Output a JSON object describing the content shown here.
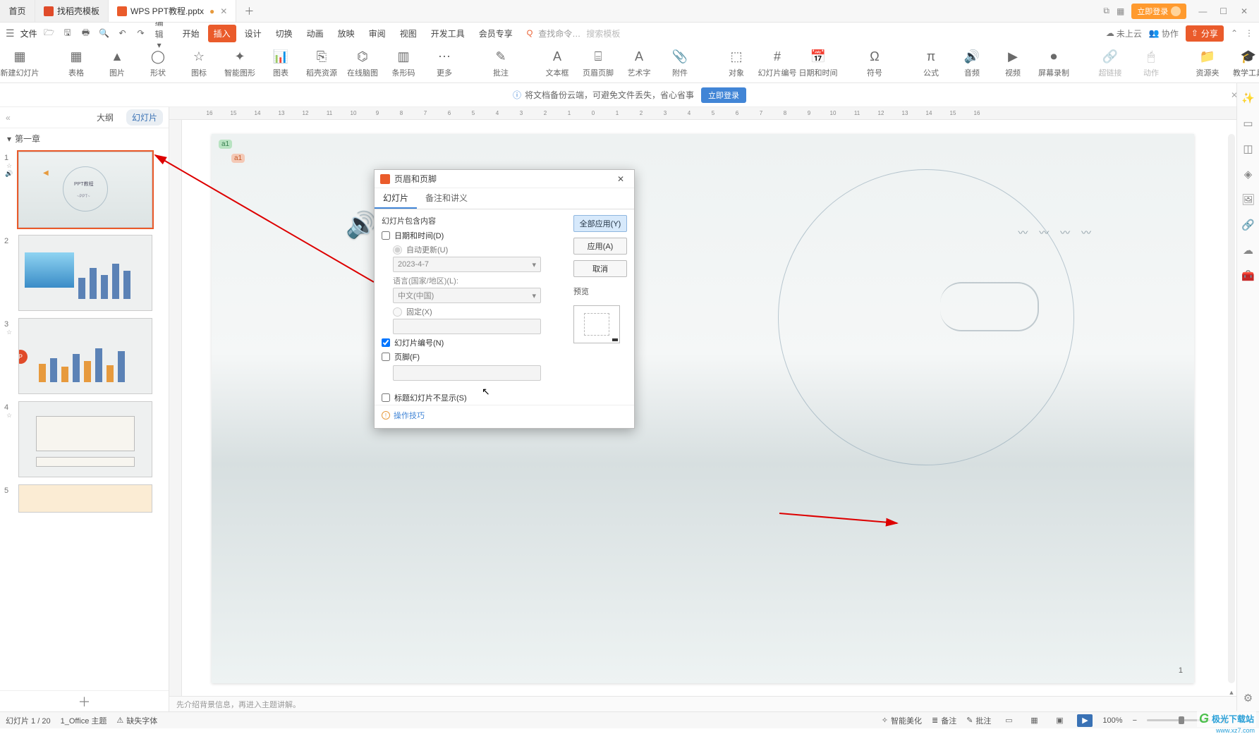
{
  "tabs": {
    "home": "首页",
    "template": "找稻壳模板",
    "current": "WPS PPT教程.pptx"
  },
  "title_right": {
    "login": "立即登录"
  },
  "menu": {
    "file": "文件",
    "edit_drop": "编辑"
  },
  "ribbon": {
    "tabs": [
      "开始",
      "插入",
      "设计",
      "切换",
      "动画",
      "放映",
      "审阅",
      "视图",
      "开发工具",
      "会员专享"
    ],
    "active_index": 1,
    "search_cmd": "查找命令…",
    "search_tpl": "搜索模板"
  },
  "right_menus": {
    "cloud": "未上云",
    "coop": "协作",
    "share": "分享"
  },
  "toolbar": [
    {
      "key": "newSlide",
      "label": "新建幻灯片",
      "glyph": "▦"
    },
    {
      "key": "table",
      "label": "表格",
      "glyph": "▦"
    },
    {
      "key": "image",
      "label": "图片",
      "glyph": "▲"
    },
    {
      "key": "shape",
      "label": "形状",
      "glyph": "◯"
    },
    {
      "key": "icon",
      "label": "图标",
      "glyph": "☆"
    },
    {
      "key": "smart",
      "label": "智能图形",
      "glyph": "✦"
    },
    {
      "key": "chart",
      "label": "图表",
      "glyph": "📊"
    },
    {
      "key": "daoke",
      "label": "稻壳资源",
      "glyph": "⎘"
    },
    {
      "key": "mindmap",
      "label": "在线脑图",
      "glyph": "⌬"
    },
    {
      "key": "barcode",
      "label": "条形码",
      "glyph": "▥"
    },
    {
      "key": "more",
      "label": "更多",
      "glyph": "⋯"
    },
    {
      "key": "comment",
      "label": "批注",
      "glyph": "✎"
    },
    {
      "key": "textbox",
      "label": "文本框",
      "glyph": "A"
    },
    {
      "key": "headerfooter",
      "label": "页眉页脚",
      "glyph": "⌸"
    },
    {
      "key": "wordart",
      "label": "艺术字",
      "glyph": "A"
    },
    {
      "key": "attach",
      "label": "附件",
      "glyph": "📎"
    },
    {
      "key": "object",
      "label": "对象",
      "glyph": "⬚",
      "inline": true
    },
    {
      "key": "slidenum",
      "label": "幻灯片编号",
      "glyph": "#",
      "inline": true
    },
    {
      "key": "datetime",
      "label": "日期和时间",
      "glyph": "📅",
      "inline": true
    },
    {
      "key": "symbol",
      "label": "符号",
      "glyph": "Ω"
    },
    {
      "key": "formula",
      "label": "公式",
      "glyph": "π"
    },
    {
      "key": "audio",
      "label": "音频",
      "glyph": "🔊"
    },
    {
      "key": "video",
      "label": "视频",
      "glyph": "▶"
    },
    {
      "key": "screenrec",
      "label": "屏幕录制",
      "glyph": "⏺"
    },
    {
      "key": "hyperlink",
      "label": "超链接",
      "glyph": "🔗",
      "dim": true
    },
    {
      "key": "action",
      "label": "动作",
      "glyph": "🖱",
      "dim": true
    },
    {
      "key": "resource",
      "label": "资源夹",
      "glyph": "📁"
    },
    {
      "key": "teach",
      "label": "教学工具",
      "glyph": "🎓"
    }
  ],
  "banner": {
    "text": "将文档备份云端，可避免文件丢失，省心省事",
    "btn": "立即登录"
  },
  "outline": {
    "tab_outline": "大纲",
    "tab_slides": "幻灯片",
    "chapter": "第一章",
    "numbers": [
      "1",
      "2",
      "3",
      "4",
      "5"
    ]
  },
  "ruler_ticks": [
    "16",
    "15",
    "14",
    "13",
    "12",
    "11",
    "10",
    "9",
    "8",
    "7",
    "6",
    "5",
    "4",
    "3",
    "2",
    "1",
    "0",
    "1",
    "2",
    "3",
    "4",
    "5",
    "6",
    "7",
    "8",
    "9",
    "10",
    "11",
    "12",
    "13",
    "14",
    "15",
    "16"
  ],
  "slide": {
    "annot1": "a1",
    "annot2": "a1",
    "page_number": "1",
    "birds": "〰 〰 〰 〰"
  },
  "dialog": {
    "title": "页眉和页脚",
    "tab_slide": "幻灯片",
    "tab_notes": "备注和讲义",
    "group_title": "幻灯片包含内容",
    "datetime": "日期和时间(D)",
    "auto": "自动更新(U)",
    "date_value": "2023-4-7",
    "lang_label": "语言(国家/地区)(L):",
    "lang_value": "中文(中国)",
    "fixed": "固定(X)",
    "slidenum": "幻灯片编号(N)",
    "footer": "页脚(F)",
    "hide_title": "标题幻灯片不显示(S)",
    "apply_all": "全部应用(Y)",
    "apply": "应用(A)",
    "cancel": "取消",
    "preview": "预览",
    "tips": "操作技巧"
  },
  "notes_placeholder": "先介绍背景信息，再进入主题讲解。",
  "status": {
    "slide": "幻灯片 1 / 20",
    "theme": "1_Office 主题",
    "missing_font": "缺失字体",
    "beautify": "智能美化",
    "notes": "备注",
    "comments": "批注",
    "zoom": "100%"
  },
  "watermark": {
    "name": "极光下载站",
    "url": "www.xz7.com"
  }
}
